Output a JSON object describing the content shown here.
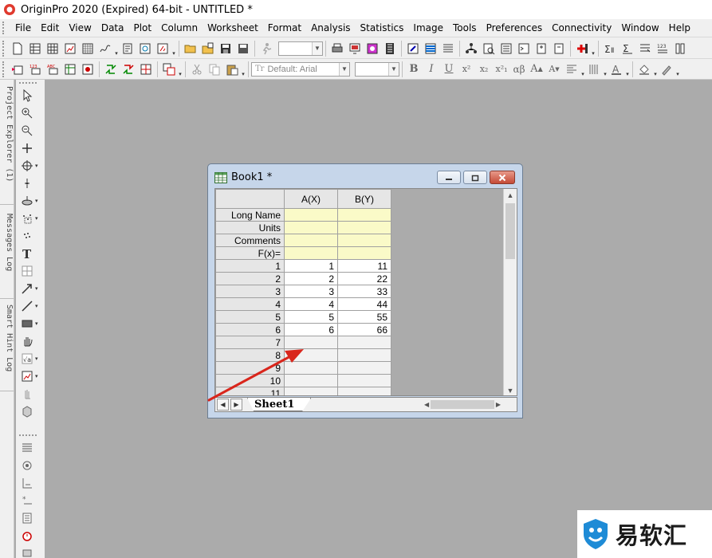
{
  "window": {
    "title": "OriginPro 2020 (Expired) 64-bit - UNTITLED *"
  },
  "menu": [
    "File",
    "Edit",
    "View",
    "Data",
    "Plot",
    "Column",
    "Worksheet",
    "Format",
    "Analysis",
    "Statistics",
    "Image",
    "Tools",
    "Preferences",
    "Connectivity",
    "Window",
    "Help"
  ],
  "toolbar": {
    "font_name": "Default: Arial",
    "font_size": "",
    "zoom_value": ""
  },
  "side_tabs": [
    "Project Explorer (1)",
    "Messages Log",
    "Smart Hint Log"
  ],
  "book": {
    "title": "Book1 *",
    "columns": [
      "A(X)",
      "B(Y)"
    ],
    "meta_rows": [
      "Long Name",
      "Units",
      "Comments",
      "F(x)="
    ],
    "rows": [
      {
        "n": "1",
        "a": "1",
        "b": "11"
      },
      {
        "n": "2",
        "a": "2",
        "b": "22"
      },
      {
        "n": "3",
        "a": "3",
        "b": "33"
      },
      {
        "n": "4",
        "a": "4",
        "b": "44"
      },
      {
        "n": "5",
        "a": "5",
        "b": "55"
      },
      {
        "n": "6",
        "a": "6",
        "b": "66"
      },
      {
        "n": "7",
        "a": "",
        "b": ""
      },
      {
        "n": "8",
        "a": "",
        "b": ""
      },
      {
        "n": "9",
        "a": "",
        "b": ""
      },
      {
        "n": "10",
        "a": "",
        "b": ""
      },
      {
        "n": "11",
        "a": "",
        "b": ""
      }
    ],
    "sheet_tab": "Sheet1"
  },
  "watermark": {
    "text": "易软汇"
  },
  "colors": {
    "annotation_arrow": "#d9261c",
    "meta_row_bg": "#fafac8",
    "workspace_bg": "#ababab"
  }
}
